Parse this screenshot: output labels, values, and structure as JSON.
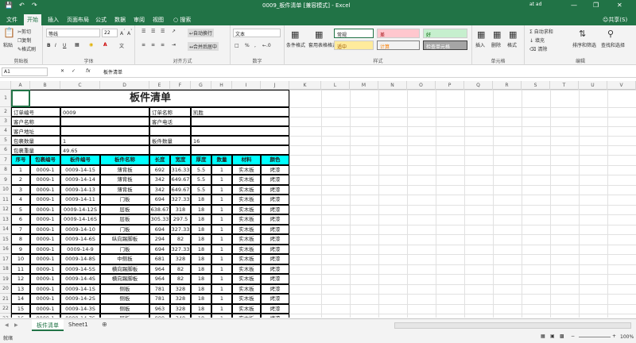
{
  "window": {
    "title": "0009_板件清单 [兼容模式] - Excel",
    "user": "at ad"
  },
  "tabs": [
    "文件",
    "开始",
    "插入",
    "页面布局",
    "公式",
    "数据",
    "审阅",
    "视图"
  ],
  "tell_me": "搜索",
  "share": "共享(S)",
  "ribbon": {
    "paste": "粘贴",
    "cut": "剪切",
    "copy": "复制",
    "format_painter": "格式刷",
    "clipboard": "剪贴板",
    "font_name": "等线",
    "font_size": "22",
    "font_group": "字体",
    "wrap_text": "自动换行",
    "merge_center": "合并后居中",
    "align_group": "对齐方式",
    "number_format": "文本",
    "number_group": "数字",
    "cond_format": "条件格式",
    "table_format": "套用表格格式",
    "styles_group": "样式",
    "style_normal": "常规",
    "style_bad": "差",
    "style_good": "好",
    "style_neutral": "适中",
    "style_calc": "计算",
    "style_check": "检查单元格",
    "insert": "插入",
    "delete": "删除",
    "format": "格式",
    "cells_group": "单元格",
    "autosum": "自动求和",
    "fill": "填充",
    "clear": "清除",
    "sort_filter": "排序和筛选",
    "find_select": "查找和选择",
    "edit_group": "编辑"
  },
  "formula_bar": {
    "name_box": "A1",
    "fx": "fx",
    "value": "板件清单"
  },
  "columns": [
    "A",
    "B",
    "C",
    "D",
    "E",
    "F",
    "G",
    "H",
    "I",
    "J",
    "K",
    "L",
    "M",
    "N",
    "O",
    "P",
    "Q",
    "R",
    "S",
    "T",
    "U",
    "V",
    "W"
  ],
  "rows": [
    "1",
    "2",
    "3",
    "4",
    "5",
    "6",
    "7",
    "8",
    "9",
    "10",
    "11",
    "12",
    "13",
    "14",
    "15",
    "16",
    "17",
    "18",
    "19",
    "20",
    "21",
    "22",
    "23",
    "24"
  ],
  "sheet": {
    "title": "板件清单",
    "info": [
      {
        "l": "订单编号",
        "v": "0009",
        "l2": "订单名称",
        "v2": "凯胜"
      },
      {
        "l": "客户名称",
        "v": "",
        "l2": "客户电话",
        "v2": ""
      },
      {
        "l": "客户地址",
        "v": "",
        "l2": "",
        "v2": ""
      },
      {
        "l": "包裹数量",
        "v": "1",
        "l2": "板件数量",
        "v2": "16"
      },
      {
        "l": "包裹重量",
        "v": "49.65",
        "l2": "",
        "v2": ""
      }
    ],
    "headers": [
      "序号",
      "包裹编号",
      "板件编号",
      "板件名称",
      "长度",
      "宽度",
      "厚度",
      "数量",
      "材料",
      "颜色"
    ],
    "data": [
      [
        "1",
        "0009-1",
        "0009-14-15",
        "薄背板",
        "692",
        "316.33",
        "5.5",
        "1",
        "实木板",
        "烤漆"
      ],
      [
        "2",
        "0009-1",
        "0009-14-14",
        "薄背板",
        "342",
        "649.67",
        "5.5",
        "1",
        "实木板",
        "烤漆"
      ],
      [
        "3",
        "0009-1",
        "0009-14-13",
        "薄背板",
        "342",
        "649.67",
        "5.5",
        "1",
        "实木板",
        "烤漆"
      ],
      [
        "4",
        "0009-1",
        "0009-14-11",
        "门板",
        "694",
        "327.33",
        "18",
        "1",
        "实木板",
        "烤漆"
      ],
      [
        "5",
        "0009-1",
        "0009-14-12S",
        "层板",
        "638.67",
        "318",
        "18",
        "1",
        "实木板",
        "烤漆"
      ],
      [
        "6",
        "0009-1",
        "0009-14-16S",
        "层板",
        "305.33",
        "297.5",
        "18",
        "1",
        "实木板",
        "烤漆"
      ],
      [
        "7",
        "0009-1",
        "0009-14-10",
        "门板",
        "694",
        "327.33",
        "18",
        "1",
        "实木板",
        "烤漆"
      ],
      [
        "8",
        "0009-1",
        "0009-14-6S",
        "纵向踢脚板",
        "294",
        "82",
        "18",
        "1",
        "实木板",
        "烤漆"
      ],
      [
        "9",
        "0009-1",
        "0009-14-9",
        "门板",
        "694",
        "327.33",
        "18",
        "1",
        "实木板",
        "烤漆"
      ],
      [
        "10",
        "0009-1",
        "0009-14-8S",
        "中侧板",
        "681",
        "328",
        "18",
        "1",
        "实木板",
        "烤漆"
      ],
      [
        "11",
        "0009-1",
        "0009-14-5S",
        "横向踢脚板",
        "964",
        "82",
        "18",
        "1",
        "实木板",
        "烤漆"
      ],
      [
        "12",
        "0009-1",
        "0009-14-4S",
        "横向踢脚板",
        "964",
        "82",
        "18",
        "1",
        "实木板",
        "烤漆"
      ],
      [
        "13",
        "0009-1",
        "0009-14-1S",
        "侧板",
        "781",
        "328",
        "18",
        "1",
        "实木板",
        "烤漆"
      ],
      [
        "14",
        "0009-1",
        "0009-14-2S",
        "侧板",
        "781",
        "328",
        "18",
        "1",
        "实木板",
        "烤漆"
      ],
      [
        "15",
        "0009-1",
        "0009-14-3S",
        "侧板",
        "963",
        "328",
        "18",
        "1",
        "实木板",
        "烤漆"
      ],
      [
        "16",
        "0009-1",
        "0009-14-7S",
        "层板",
        "999",
        "348",
        "18",
        "1",
        "实木板",
        "烤漆"
      ]
    ]
  },
  "sheet_tabs": [
    "板件清单",
    "Sheet1"
  ],
  "status": {
    "mode": "就绪",
    "zoom": "100%"
  },
  "colors": {
    "excel_green": "#217346",
    "header_cyan": "#00ffff"
  }
}
